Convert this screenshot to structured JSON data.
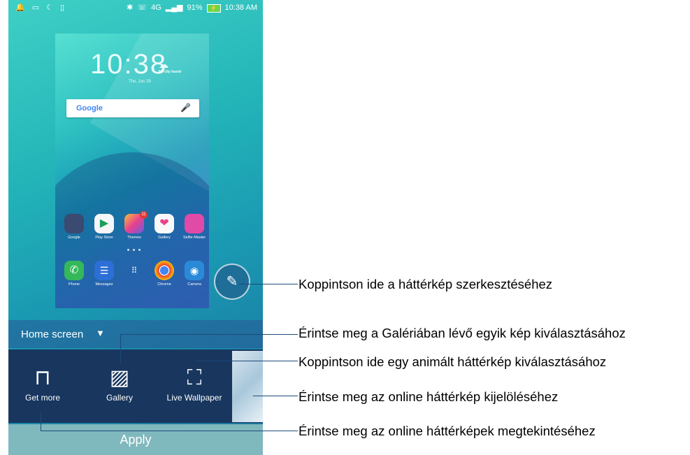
{
  "statusbar": {
    "left_icons": [
      "alarm-icon",
      "image-icon",
      "moon-icon",
      "sd-card-icon"
    ],
    "bluetooth_icon": "bluetooth-icon",
    "call_icon": "wifi-call-icon",
    "network": "4G",
    "battery_percent": "91%",
    "battery_glyph": "⚡",
    "time": "10:38 AM"
  },
  "preview": {
    "clock": "10:38",
    "weather": "No city found",
    "date": "Thu, Jun 29",
    "search_logo": "Google",
    "apps_row1": [
      {
        "label": "Google",
        "color": "#3a4a70"
      },
      {
        "label": "Play Store",
        "color": "#f4f6f8"
      },
      {
        "label": "Themes",
        "color": "#f06a3a",
        "badge": "11"
      },
      {
        "label": "Gallery",
        "color": "#f9f9f9"
      },
      {
        "label": "Selfie Master",
        "color": "#e24aa8"
      }
    ],
    "apps_row2": [
      {
        "label": "Phone",
        "color": "#34b85a"
      },
      {
        "label": "Messages",
        "color": "#2c6fd6"
      },
      {
        "label": "",
        "color": "transparent"
      },
      {
        "label": "Chrome",
        "color": "#ffffff"
      },
      {
        "label": "Camera",
        "color": "#2a8ad8"
      }
    ]
  },
  "home_screen_selector": {
    "label": "Home screen"
  },
  "options": {
    "get_more": "Get more",
    "gallery": "Gallery",
    "live_wallpaper": "Live Wallpaper"
  },
  "apply_label": "Apply",
  "annotations": {
    "edit": "Koppintson ide a háttérkép szerkesztéséhez",
    "gallery": "Érintse meg a Galériában lévő egyik kép kiválasztásához",
    "live": "Koppintson ide egy animált háttérkép kiválasztásához",
    "online_select": "Érintse meg az online háttérkép kijelöléséhez",
    "online_view": "Érintse meg az online háttérképek megtekintéséhez"
  }
}
